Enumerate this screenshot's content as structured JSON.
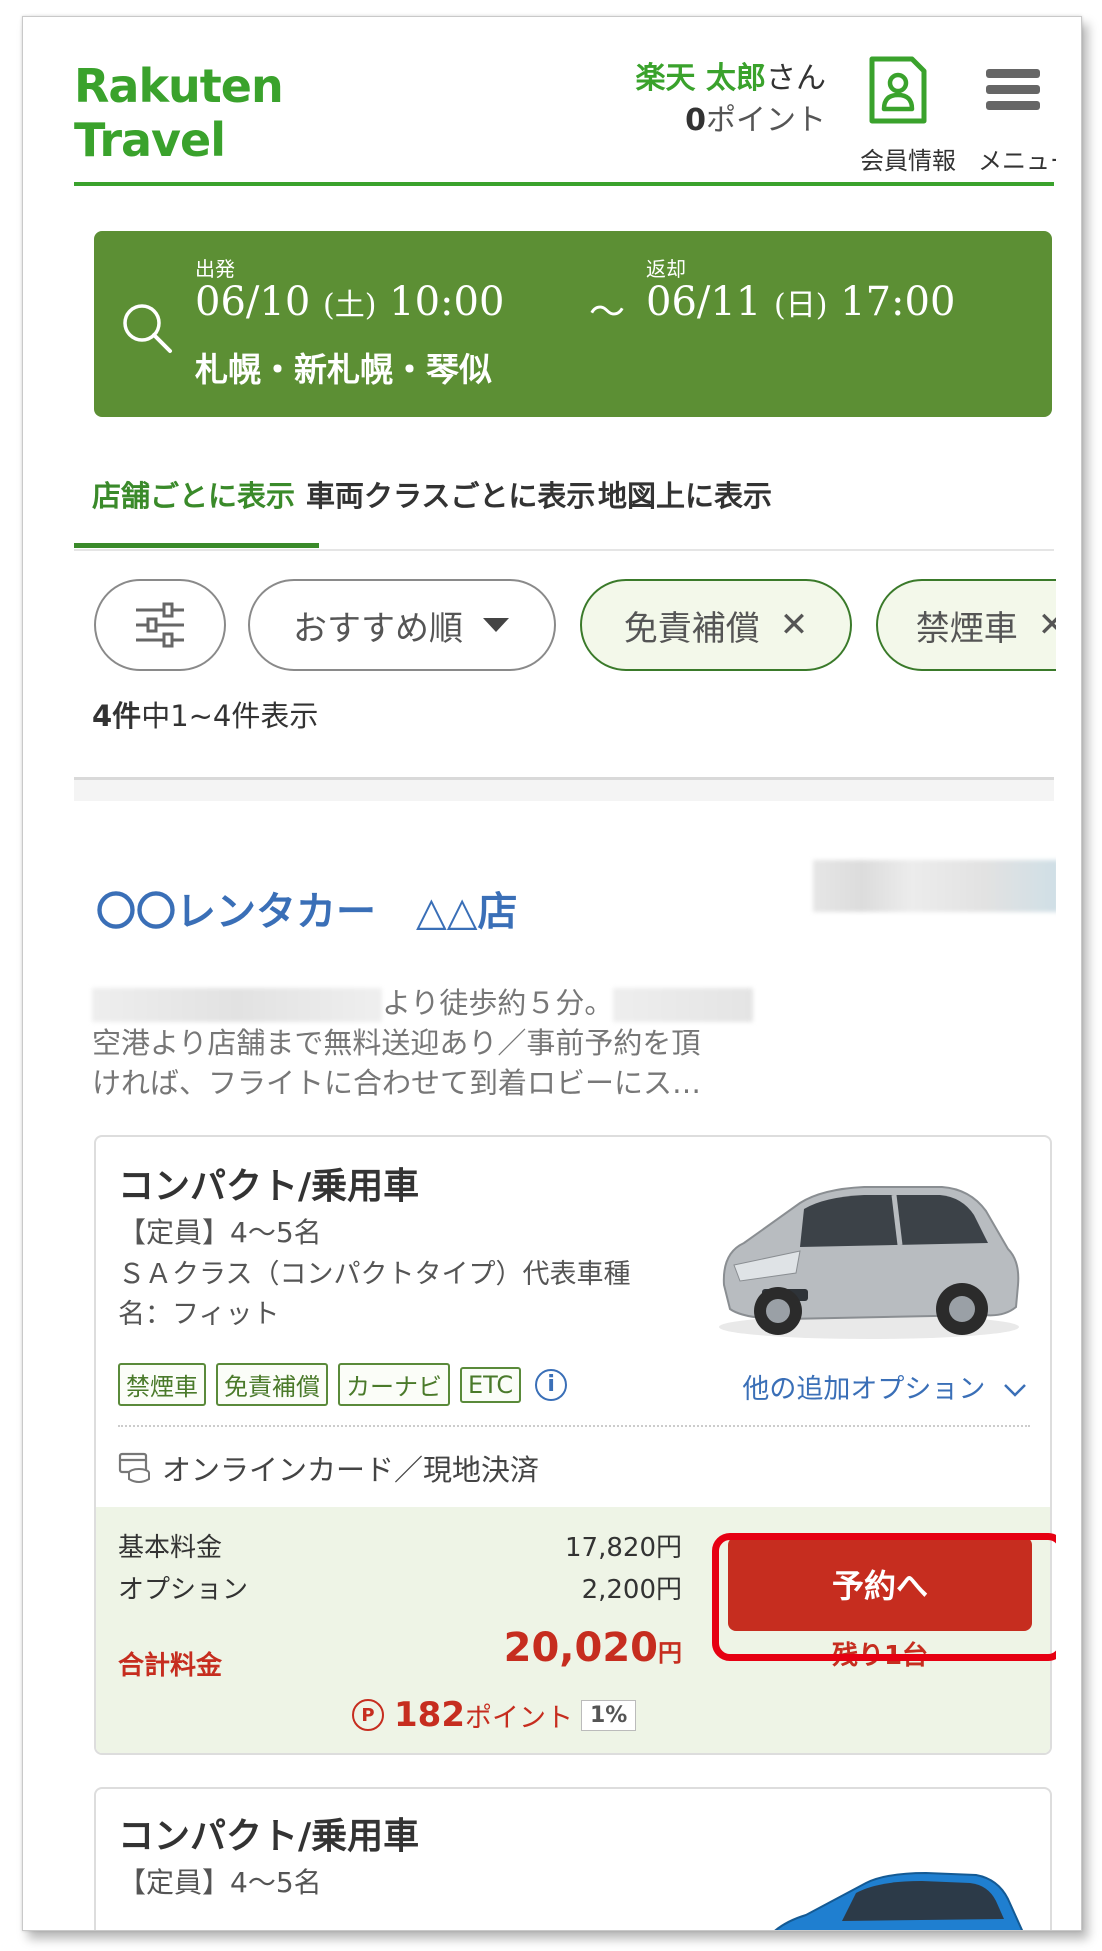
{
  "header": {
    "logo_line1": "Rakuten",
    "logo_line2": "Travel",
    "user_name": "楽天 太郎",
    "user_suffix": "さん",
    "points_value": "0",
    "points_unit": "ポイント",
    "member_label": "会員情報",
    "menu_label": "メニュー"
  },
  "search": {
    "departure_label": "出発",
    "departure_date": "06/10",
    "departure_day": "(土)",
    "departure_time": "10:00",
    "separator": "～",
    "return_label": "返却",
    "return_date": "06/11",
    "return_day": "(日)",
    "return_time": "17:00",
    "location": "札幌・新札幌・琴似"
  },
  "tabs": [
    {
      "label": "店舗ごとに表示",
      "active": true
    },
    {
      "label": "車両クラスごとに表示",
      "active": false
    },
    {
      "label": "地図上に表示",
      "active": false
    }
  ],
  "filters": {
    "sort_label": "おすすめ順",
    "chips": [
      "免責補償",
      "禁煙車"
    ],
    "remove_symbol": "✕"
  },
  "results": {
    "total": "4件",
    "range_text": "中1~4件表示"
  },
  "store": {
    "name": "〇〇レンタカー　△△店",
    "desc_line1": "より徒歩約５分。",
    "desc_line2": "空港より店舗まで無料送迎あり／事前予約を頂",
    "desc_line3": "ければ、フライトに合わせて到着ロビーにス…"
  },
  "plans": [
    {
      "title": "コンパクト/乗用車",
      "capacity": "【定員】4～5名",
      "model": "ＳＡクラス（コンパクトタイプ）代表車種名：フィット",
      "tags": [
        "禁煙車",
        "免責補償",
        "カーナビ",
        "ETC"
      ],
      "more_options": "他の追加オプション",
      "payment": "オンラインカード／現地決済",
      "base_label": "基本料金",
      "base_price": "17,820円",
      "option_label": "オプション",
      "option_price": "2,200円",
      "total_label": "合計料金",
      "total_price": "20,020",
      "total_unit": "円",
      "points": "182",
      "points_unit": "ポイント",
      "points_rate": "1%",
      "reserve_label": "予約へ",
      "remaining": "残り1台",
      "car_color": "#b8bcc0"
    },
    {
      "title": "コンパクト/乗用車",
      "capacity": "【定員】4～5名",
      "car_color": "#1f7fd0"
    }
  ],
  "colors": {
    "brand_green": "#3aa22c",
    "search_bg": "#5c8f34",
    "link_blue": "#3a6fb7",
    "accent_red": "#c62d1f",
    "highlight_red": "#e60012"
  }
}
